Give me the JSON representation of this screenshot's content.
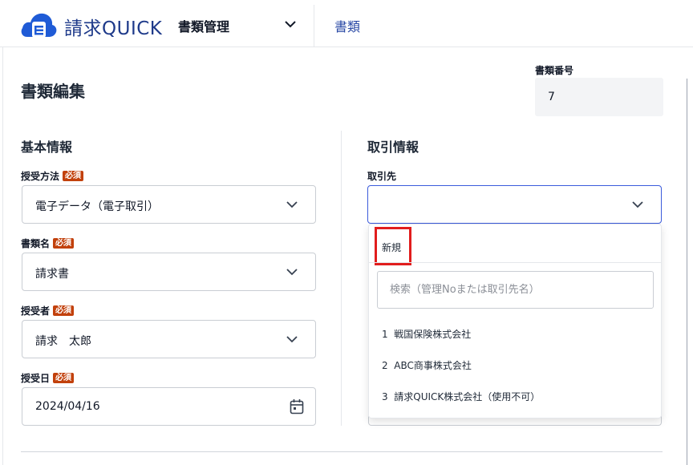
{
  "header": {
    "brand_kanji": "請求",
    "brand_latin": "QUICK",
    "menu_title": "書類管理",
    "nav_link": "書類"
  },
  "page": {
    "title": "書類編集",
    "doc_number_label": "書類番号",
    "doc_number_value": "7"
  },
  "basic_info": {
    "title": "基本情報",
    "required_badge": "必須",
    "fields": [
      {
        "label": "授受方法",
        "value": "電子データ（電子取引）"
      },
      {
        "label": "書類名",
        "value": "請求書"
      },
      {
        "label": "授受者",
        "value": "請求　太郎"
      },
      {
        "label": "授受日",
        "value": "2024/04/16"
      }
    ]
  },
  "transaction_info": {
    "title": "取引情報",
    "client_label": "取引先",
    "client_value": ""
  },
  "dropdown": {
    "new_label": "新規",
    "search_placeholder": "検索（管理Noまたは取引先名）",
    "options": [
      "1  戦国保険株式会社",
      "2  ABC商事株式会社",
      "3  請求QUICK株式会社（使用不可）"
    ]
  },
  "colors": {
    "brand_blue": "#1f5bd6",
    "nav_blue": "#2b4aa6",
    "required_badge": "#c2410c",
    "highlight_red": "#e11d1d",
    "focus_border": "#3b5bdb"
  }
}
